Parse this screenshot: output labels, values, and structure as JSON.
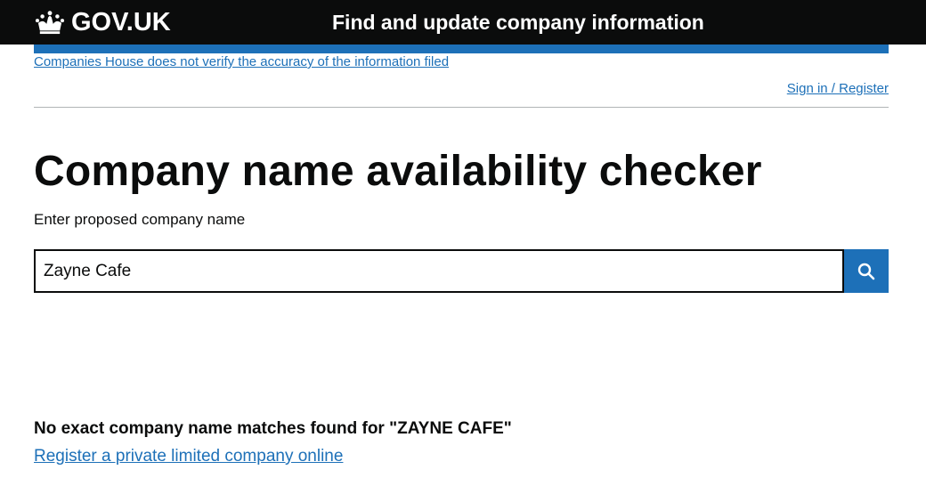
{
  "header": {
    "logo_text": "GOV.UK",
    "service_name": "Find and update company information",
    "logo_icon": "crown-icon"
  },
  "banner": {
    "disclaimer": "Companies House does not verify the accuracy of the information filed"
  },
  "account": {
    "signin_label": "Sign in / Register"
  },
  "main": {
    "title": "Company name availability checker",
    "field_label": "Enter proposed company name",
    "search_value": "Zayne Cafe",
    "search_icon": "search-icon",
    "result_message": "No exact company name matches found for \"ZAYNE CAFE\"",
    "register_link": "Register a private limited company online"
  },
  "colors": {
    "header_bg": "#0b0c0c",
    "brand_blue": "#1d70b8",
    "text": "#0b0c0c",
    "divider": "#b1b4b6"
  }
}
